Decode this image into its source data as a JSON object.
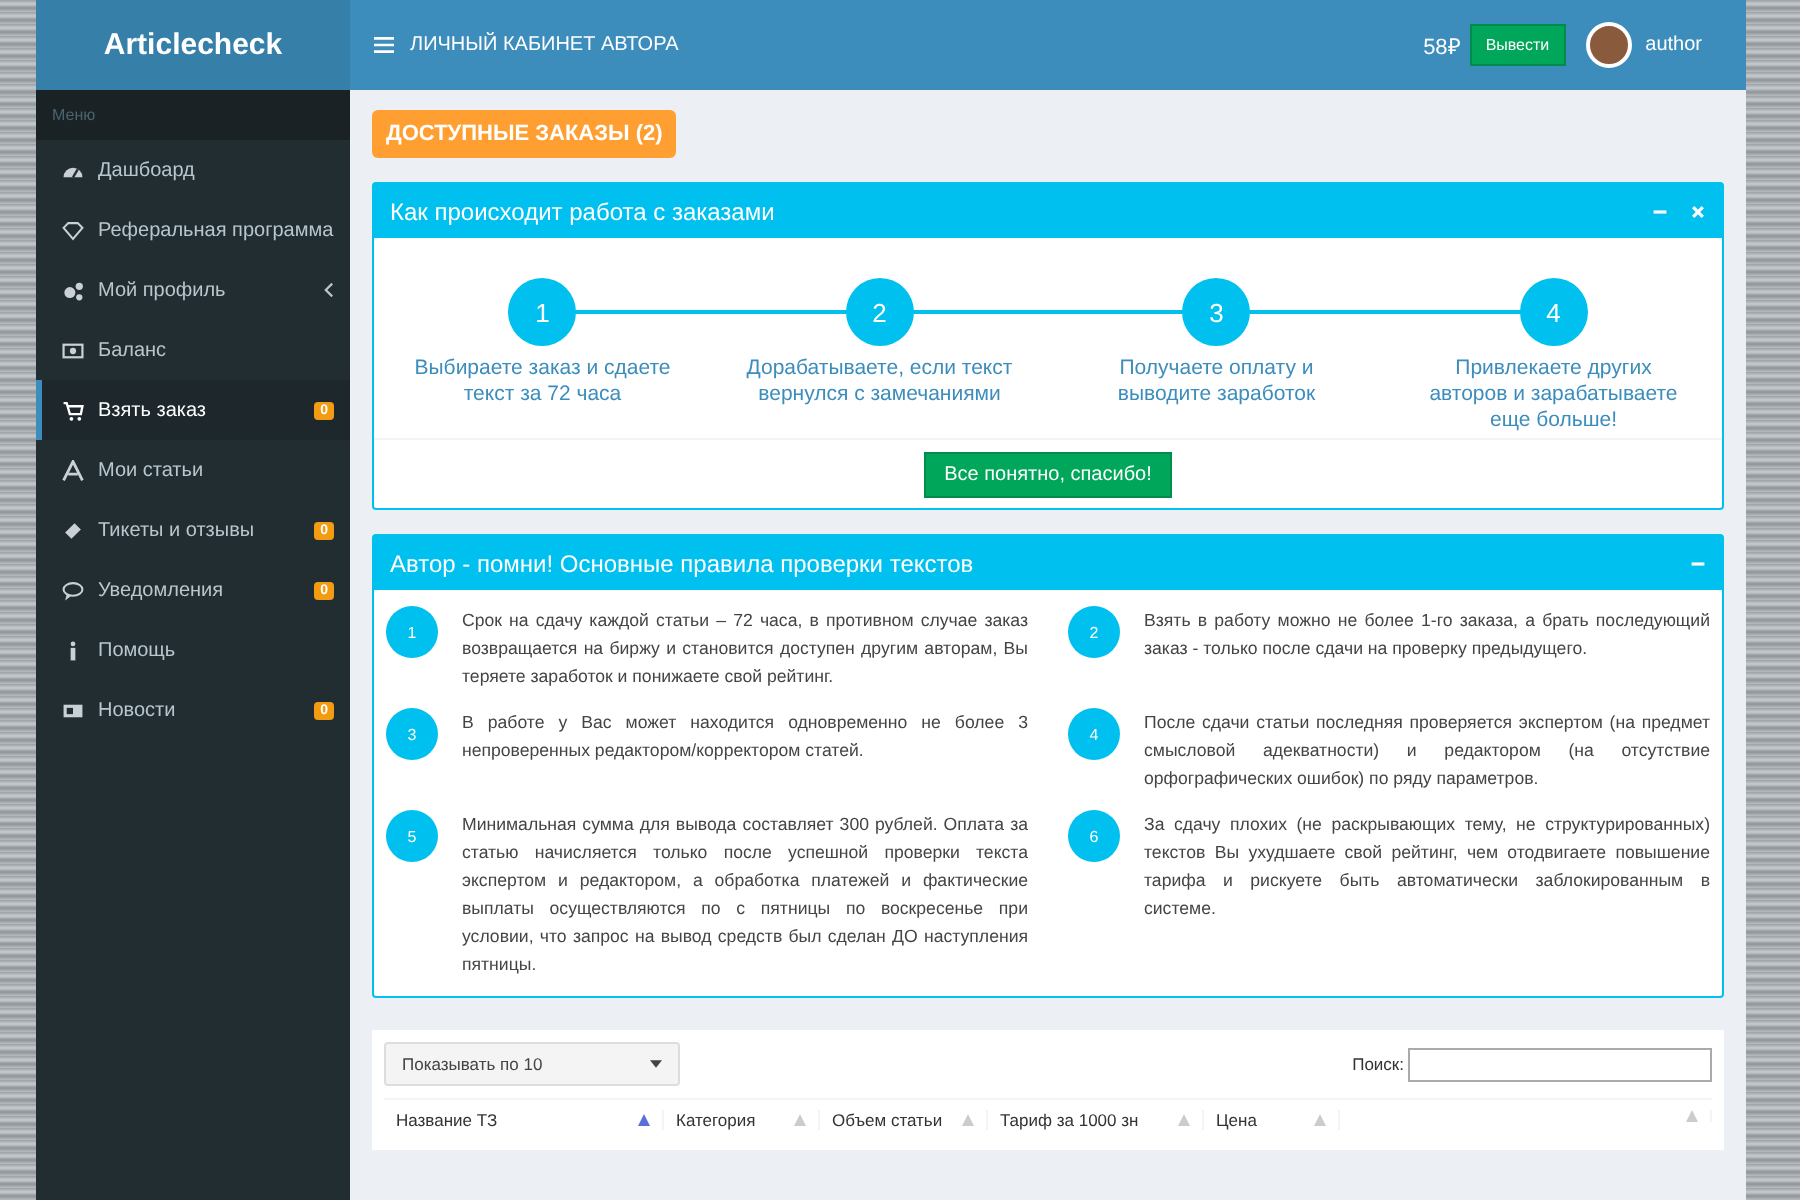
{
  "brand": "Articlecheck",
  "header": {
    "title": "ЛИЧНЫЙ КАБИНЕТ АВТОРА",
    "balance": "58₽",
    "withdraw_button": "Вывести",
    "username": "author"
  },
  "sidebar": {
    "heading": "Меню",
    "items": [
      {
        "label": "Дашбоард",
        "selected": false
      },
      {
        "label": "Реферальная программа",
        "selected": false
      },
      {
        "label": "Мой профиль",
        "selected": false,
        "has_submenu": true
      },
      {
        "label": "Баланс",
        "selected": false
      },
      {
        "label": "Взять заказ",
        "selected": true,
        "badge": "0"
      },
      {
        "label": "Мои статьи",
        "selected": false
      },
      {
        "label": "Тикеты и отзывы",
        "selected": false,
        "badge": "0"
      },
      {
        "label": "Уведомления",
        "selected": false,
        "badge": "0"
      },
      {
        "label": "Помощь",
        "selected": false
      },
      {
        "label": "Новости",
        "selected": false,
        "badge": "0"
      }
    ]
  },
  "orders_button": "ДОСТУПНЫЕ ЗАКАЗЫ (2)",
  "how_it_works": {
    "title": "Как происходит работа с заказами",
    "closable": true,
    "steps": [
      {
        "number": "1",
        "text": "Выбираете заказ и сдаете текст за 72 часа"
      },
      {
        "number": "2",
        "text": "Дорабатываете, если текст вернулся с замечаниями"
      },
      {
        "number": "3",
        "text": "Получаете оплату и выводите заработок"
      },
      {
        "number": "4",
        "text": "Привлекаете других авторов и зарабатываете еще больше!"
      }
    ],
    "confirm_button": "Все понятно, спасибо!"
  },
  "rules": {
    "title": "Автор - помни! Основные правила проверки текстов",
    "items": [
      {
        "number": "1",
        "text": "Срок на сдачу каждой статьи – 72 часа, в противном случае заказ возвращается на биржу и становится доступен другим авторам, Вы теряете заработок и понижаете свой рейтинг."
      },
      {
        "number": "2",
        "text": "Взять в работу можно не более 1-го заказа, а брать последующий заказ - только после сдачи на проверку предыдущего."
      },
      {
        "number": "3",
        "text": "В работе у Вас может находится одновременно не более 3 непроверенных редактором/корректором статей."
      },
      {
        "number": "4",
        "text": "После сдачи статьи последняя проверяется экспертом (на предмет смысловой адекватности) и редактором (на отсутствие орфографических ошибок) по ряду параметров."
      },
      {
        "number": "5",
        "text": "Минимальная сумма для вывода составляет 300 рублей. Оплата за статью начисляется только после успешной проверки текста экспертом и редактором, а обработка платежей и фактические выплаты осуществляются по с пятницы по воскресенье при условии, что запрос на вывод средств был сделан ДО наступления пятницы."
      },
      {
        "number": "6",
        "text": "За сдачу плохих (не раскрывающих тему, не структурированных) текстов Вы ухудшаете свой рейтинг, чем отодвигаете повышение тарифа и рискуете быть автоматически заблокированным в системе."
      }
    ]
  },
  "table": {
    "page_size": "Показывать по 10",
    "search_label": "Поиск:",
    "columns": [
      {
        "label": "Название ТЗ",
        "sorted": true
      },
      {
        "label": "Категория",
        "sorted": false
      },
      {
        "label": "Объем статьи",
        "sorted": false
      },
      {
        "label": "Тариф за 1000 зн",
        "sorted": false
      },
      {
        "label": "Цена",
        "sorted": false
      },
      {
        "sorted": false
      }
    ]
  }
}
